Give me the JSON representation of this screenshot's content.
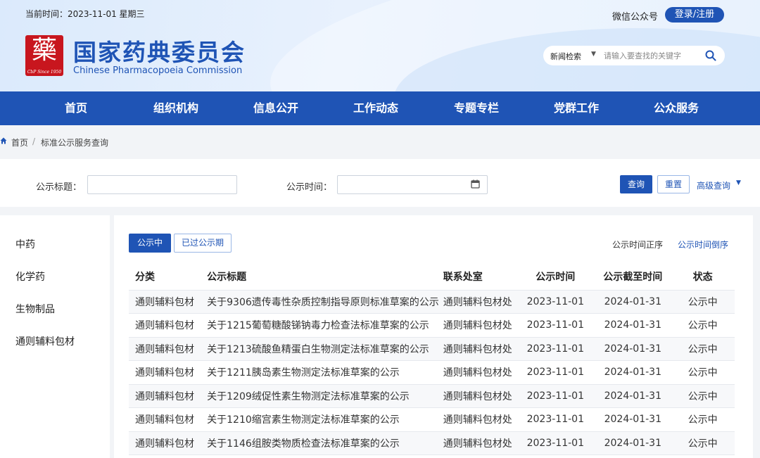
{
  "header": {
    "date_line": "当前时间：2023-11-01 星期三",
    "logo_since": "CbP Since 1950",
    "site_title": "国家药典委员会",
    "site_subtitle": "Chinese Pharmacopoeia Commission",
    "wechat": "微信公众号",
    "login_label": "登录/注册",
    "search": {
      "scope": "新闻检索",
      "placeholder": "请输入要查找的关键字"
    }
  },
  "nav": [
    "首页",
    "组织机构",
    "信息公开",
    "工作动态",
    "专题专栏",
    "党群工作",
    "公众服务"
  ],
  "breadcrumb": {
    "home": "首页",
    "separator": "/",
    "current": "标准公示服务查询"
  },
  "filter": {
    "title_label": "公示标题：",
    "title_value": "",
    "time_label": "公示时间：",
    "time_value": "",
    "query_label": "查询",
    "reset_label": "重置",
    "advanced_label": "高级查询"
  },
  "sidebar": [
    "中药",
    "化学药",
    "生物制品",
    "通则辅料包材"
  ],
  "tabs": {
    "active": "公示中",
    "inactive": "已过公示期"
  },
  "sort": {
    "asc": "公示时间正序",
    "desc": "公示时间倒序"
  },
  "table": {
    "headers": [
      "分类",
      "公示标题",
      "联系处室",
      "公示时间",
      "公示截至时间",
      "状态"
    ],
    "rows": [
      [
        "通则辅料包材",
        "关于9306遗传毒性杂质控制指导原则标准草案的公示",
        "通则辅料包材处",
        "2023-11-01",
        "2024-01-31",
        "公示中"
      ],
      [
        "通则辅料包材",
        "关于1215葡萄糖酸锑钠毒力检查法标准草案的公示",
        "通则辅料包材处",
        "2023-11-01",
        "2024-01-31",
        "公示中"
      ],
      [
        "通则辅料包材",
        "关于1213硫酸鱼精蛋白生物测定法标准草案的公示",
        "通则辅料包材处",
        "2023-11-01",
        "2024-01-31",
        "公示中"
      ],
      [
        "通则辅料包材",
        "关于1211胰岛素生物测定法标准草案的公示",
        "通则辅料包材处",
        "2023-11-01",
        "2024-01-31",
        "公示中"
      ],
      [
        "通则辅料包材",
        "关于1209绒促性素生物测定法标准草案的公示",
        "通则辅料包材处",
        "2023-11-01",
        "2024-01-31",
        "公示中"
      ],
      [
        "通则辅料包材",
        "关于1210缩宫素生物测定法标准草案的公示",
        "通则辅料包材处",
        "2023-11-01",
        "2024-01-31",
        "公示中"
      ],
      [
        "通则辅料包材",
        "关于1146组胺类物质检查法标准草案的公示",
        "通则辅料包材处",
        "2023-11-01",
        "2024-01-31",
        "公示中"
      ]
    ]
  },
  "colors": {
    "brand": "#1f54b5",
    "status": "#1f6fe0",
    "logo_red": "#c8161e"
  }
}
